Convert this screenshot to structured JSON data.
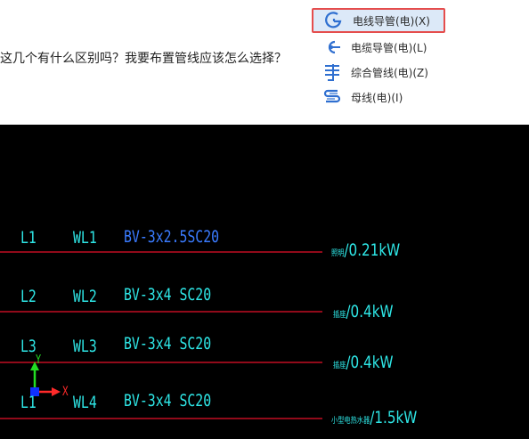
{
  "question_text": "这几个有什么区别吗？我要布置管线应该怎么选择？",
  "menu": {
    "items": [
      {
        "label": "电线导管(电)(X)",
        "icon": "conduit-hook-icon",
        "selected": true
      },
      {
        "label": "电缆导管(电)(L)",
        "icon": "cable-conduit-icon",
        "selected": false
      },
      {
        "label": "综合管线(电)(Z)",
        "icon": "integrated-pipeline-icon",
        "selected": false
      },
      {
        "label": "母线(电)(I)",
        "icon": "busbar-icon",
        "selected": false
      }
    ]
  },
  "cad": {
    "circuits": [
      {
        "phase": "L1",
        "circuit": "WL1",
        "spec": "BV-3x2.5SC20",
        "load_label": "照明",
        "load_value": "/0.21kW",
        "highlight": true
      },
      {
        "phase": "L2",
        "circuit": "WL2",
        "spec": "BV-3x4 SC20",
        "load_label": "插座",
        "load_value": "/0.4kW",
        "highlight": false
      },
      {
        "phase": "L3",
        "circuit": "WL3",
        "spec": "BV-3x4 SC20",
        "load_label": "插座",
        "load_value": "/0.4kW",
        "highlight": false
      },
      {
        "phase": "L1",
        "circuit": "WL4",
        "spec": "BV-3x4 SC20",
        "load_label": "小型电热水器",
        "load_value": "/1.5kW",
        "highlight": false
      }
    ],
    "ucs": {
      "x_label": "X",
      "y_label": "Y"
    },
    "colors": {
      "line": "#e8102a",
      "text": "#2ee6e6",
      "highlight_text": "#3a7bff",
      "axis_x": "#ff2a2a",
      "axis_y": "#22dd22",
      "origin": "#1030ff"
    }
  }
}
